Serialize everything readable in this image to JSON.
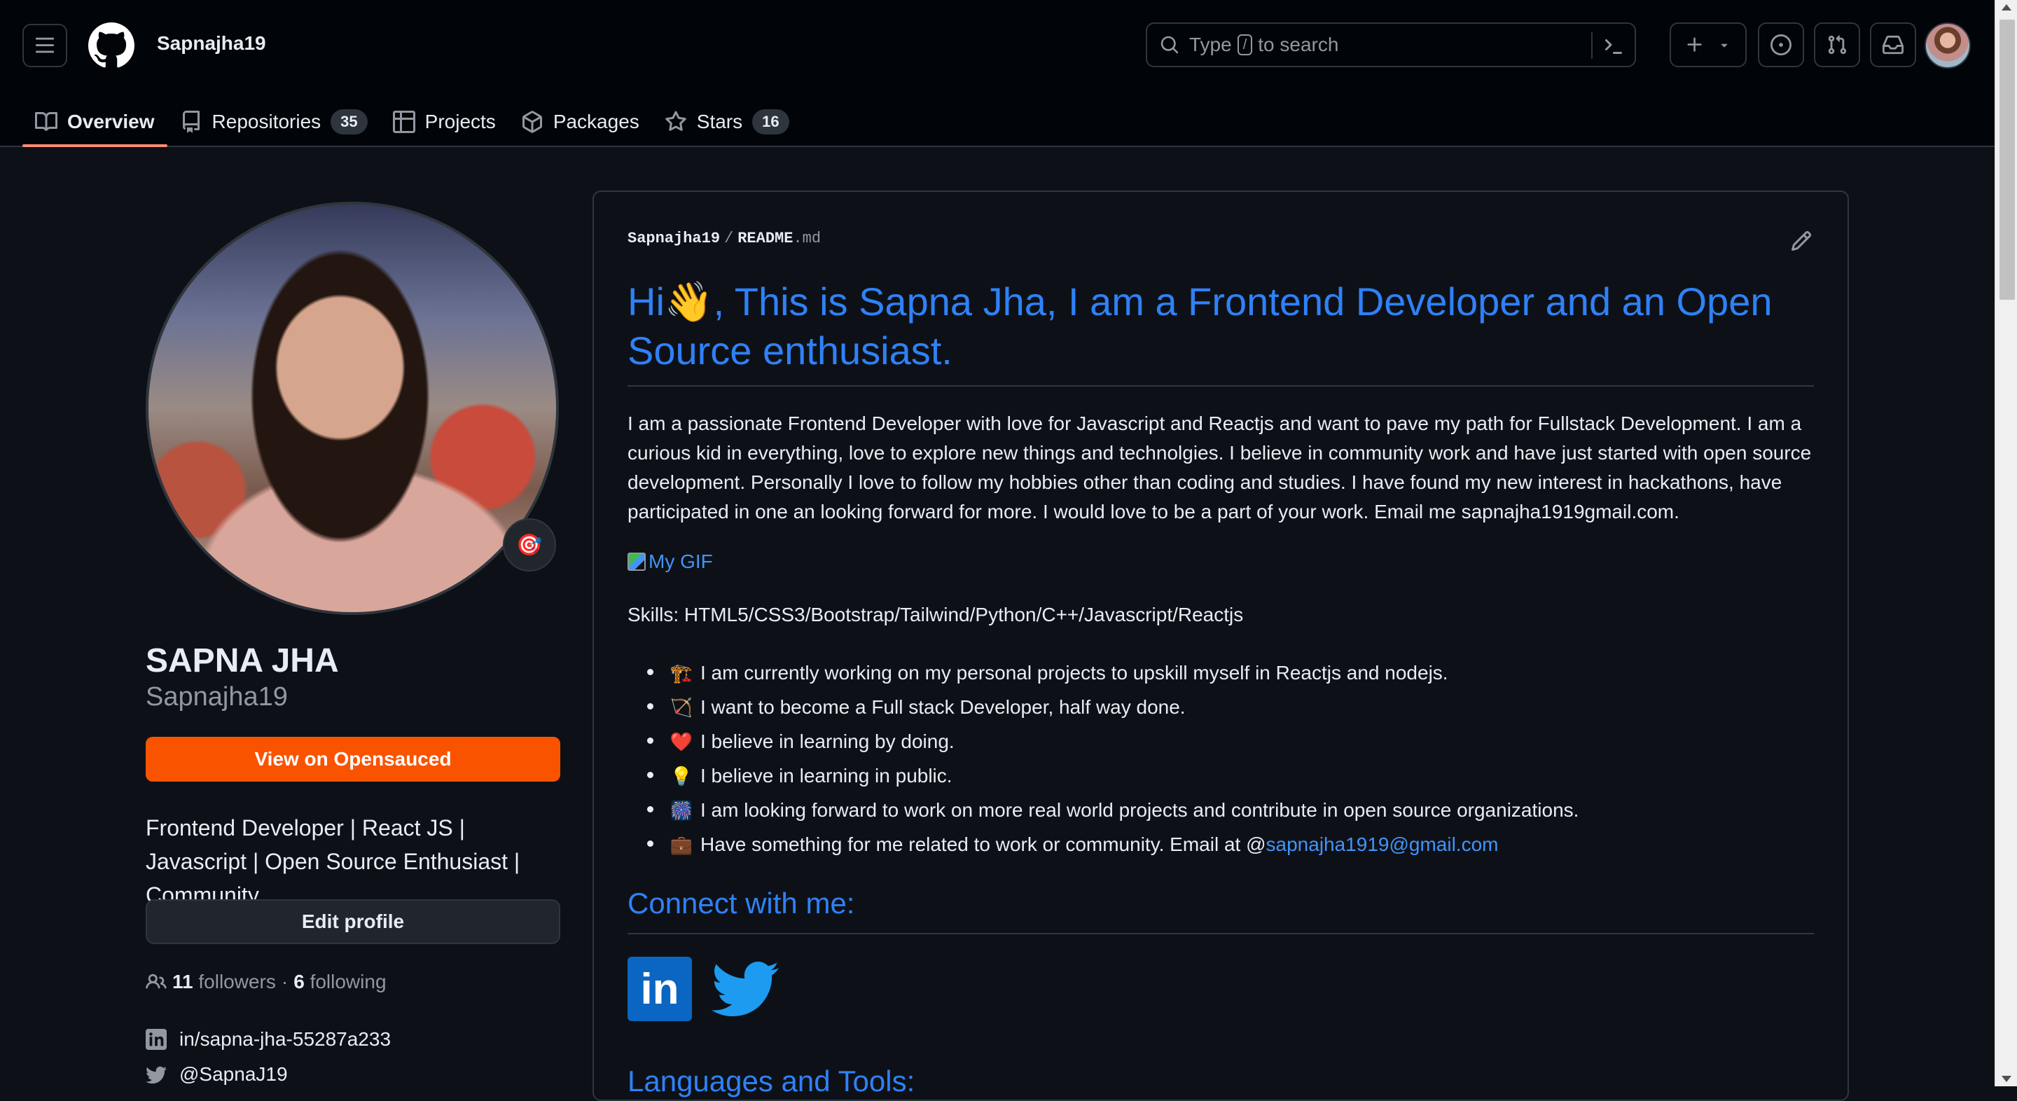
{
  "header": {
    "username": "Sapnajha19",
    "search": {
      "prefix": "Type",
      "slash": "/",
      "suffix": "to search"
    }
  },
  "tabs": [
    {
      "label": "Overview",
      "icon": "book-icon",
      "active": true
    },
    {
      "label": "Repositories",
      "icon": "repo-icon",
      "count": "35"
    },
    {
      "label": "Projects",
      "icon": "table-icon"
    },
    {
      "label": "Packages",
      "icon": "package-icon"
    },
    {
      "label": "Stars",
      "icon": "star-icon",
      "count": "16"
    }
  ],
  "profile": {
    "full_name": "SAPNA JHA",
    "login": "Sapnajha19",
    "opensauced_button": "View on Opensauced",
    "bio": "Frontend Developer | React JS | Javascript | Open Source Enthusiast | Community",
    "edit_button": "Edit profile",
    "followers_count": "11",
    "followers_label": "followers",
    "separator": "·",
    "following_count": "6",
    "following_label": "following",
    "linkedin": "in/sapna-jha-55287a233",
    "twitter": "@SapnaJ19",
    "status_emoji": "🎯"
  },
  "readme": {
    "path_owner": "Sapnajha19",
    "path_sep": "/",
    "path_file": "README",
    "path_ext": ".md",
    "heading_start": "Hi",
    "heading_emoji": "👋",
    "heading_rest": ", This is Sapna Jha, I am a Frontend Developer and an Open Source enthusiast.",
    "intro": "I am a passionate Frontend Developer with love for Javascript and Reactjs and want to pave my path for Fullstack Development. I am a curious kid in everything, love to explore new things and technolgies. I believe in community work and have just started with open source development. Personally I love to follow my hobbies other than coding and studies. I have found my new interest in hackathons, have participated in one an looking forward for more. I would love to be a part of your work. Email me sapnajha1919gmail.com.",
    "gif_alt": "My GIF",
    "skills": "Skills: HTML5/CSS3/Bootstrap/Tailwind/Python/C++/Javascript/Reactjs",
    "list": [
      {
        "emoji": "🏗️",
        "text": "I am currently working on my personal projects to upskill myself in Reactjs and nodejs."
      },
      {
        "emoji": "🏹",
        "text": "I want to become a Full stack Developer, half way done."
      },
      {
        "emoji": "❤️",
        "text": "I believe in learning by doing."
      },
      {
        "emoji": "💡",
        "text": "I believe in learning in public."
      },
      {
        "emoji": "🎆",
        "text": "I am looking forward to work on more real world projects and contribute in open source organizations."
      },
      {
        "emoji": "💼",
        "text": "Have something for me related to work or community. Email at @",
        "link": "sapnajha1919@gmail.com"
      }
    ],
    "connect_heading": "Connect with me:",
    "linkedin_label": "in",
    "languages_heading": "Languages and Tools:"
  }
}
